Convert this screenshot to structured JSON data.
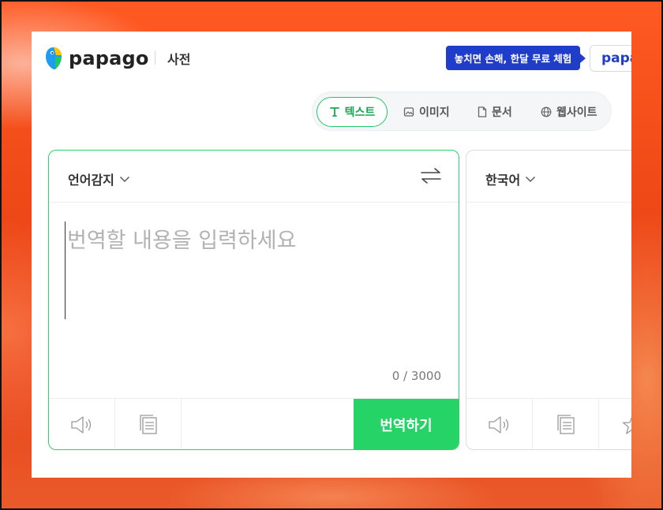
{
  "header": {
    "logo_text": "papago",
    "dictionary_link": "사전",
    "promo_text": "놓치면 손해, 한달 무료 체험",
    "plus_button": "papa"
  },
  "tabs": [
    {
      "label": "텍스트",
      "icon": "text-T-icon",
      "active": true
    },
    {
      "label": "이미지",
      "icon": "image-icon",
      "active": false
    },
    {
      "label": "문서",
      "icon": "document-icon",
      "active": false
    },
    {
      "label": "웹사이트",
      "icon": "globe-icon",
      "active": false
    }
  ],
  "source": {
    "language": "언어감지",
    "placeholder": "번역할 내용을 입력하세요",
    "value": "",
    "char_count": "0 / 3000",
    "translate_button": "번역하기"
  },
  "target": {
    "language": "한국어"
  },
  "colors": {
    "accent_green": "#25d366",
    "promo_blue": "#1f3dc8"
  }
}
